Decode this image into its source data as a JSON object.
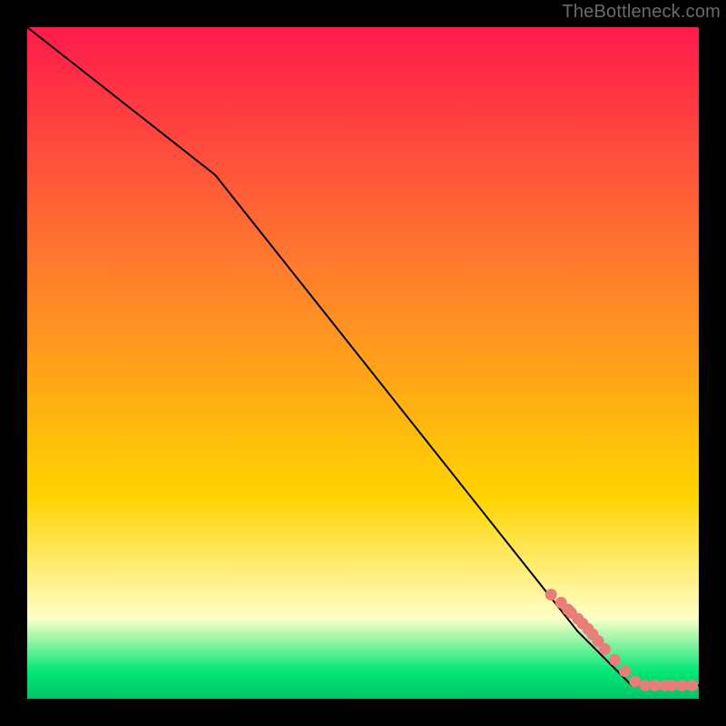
{
  "watermark": "TheBottleneck.com",
  "colors": {
    "gradient_top": "#ff1a4b",
    "gradient_mid1": "#ff7a2e",
    "gradient_mid2": "#ffd400",
    "gradient_pale": "#ffffc8",
    "gradient_green": "#00e676",
    "line": "#000000",
    "marker": "#e77f78",
    "frame": "#000000"
  },
  "chart_data": {
    "type": "line",
    "title": "",
    "xlabel": "",
    "ylabel": "",
    "xlim": [
      0,
      100
    ],
    "ylim": [
      0,
      100
    ],
    "grid": false,
    "legend": false,
    "gradient_direction": "top-to-bottom",
    "gradient_stops": [
      {
        "offset": 0,
        "value": 100,
        "color": "#ff1a4b"
      },
      {
        "offset": 35,
        "value": 65,
        "color": "#ff7a2e"
      },
      {
        "offset": 70,
        "value": 30,
        "color": "#ffd400"
      },
      {
        "offset": 88,
        "value": 12,
        "color": "#ffffc8"
      },
      {
        "offset": 96,
        "value": 4,
        "color": "#00e676"
      },
      {
        "offset": 100,
        "value": 0,
        "color": "#00c566"
      }
    ],
    "series": [
      {
        "name": "bottleneck-curve",
        "type": "line",
        "x": [
          0,
          28,
          82,
          90,
          100
        ],
        "y": [
          100,
          78,
          10,
          2,
          2
        ]
      },
      {
        "name": "marker-points",
        "type": "scatter",
        "x": [
          78,
          79.5,
          80.5,
          81,
          82,
          82.7,
          83.5,
          84.2,
          85,
          86,
          87.5,
          89,
          90.5,
          92,
          93.5,
          95,
          96,
          97.5,
          99
        ],
        "y": [
          15.5,
          14.3,
          13.3,
          12.8,
          11.9,
          11.2,
          10.4,
          9.6,
          8.6,
          7.4,
          5.8,
          4.1,
          2.6,
          2.0,
          2.0,
          2.0,
          2.0,
          2.0,
          2.0
        ]
      }
    ]
  }
}
